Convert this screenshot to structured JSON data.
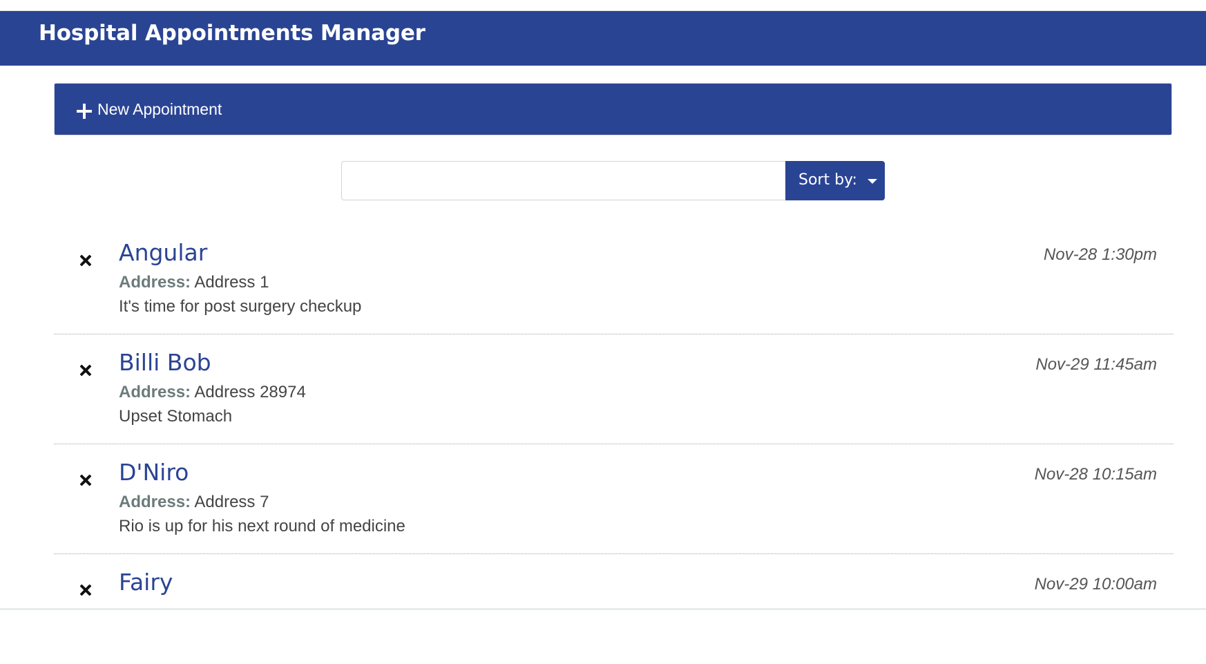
{
  "app": {
    "title": "Hospital Appointments Manager"
  },
  "toolbar": {
    "new_appointment_label": "New Appointment"
  },
  "search": {
    "value": "",
    "placeholder": ""
  },
  "sort": {
    "label": "Sort by:"
  },
  "appointments": [
    {
      "name": "Angular",
      "address_label": "Address:",
      "address": "Address 1",
      "notes": "It's time for post surgery checkup",
      "date": "Nov-28 1:30pm"
    },
    {
      "name": "Billi Bob",
      "address_label": "Address:",
      "address": "Address 28974",
      "notes": "Upset Stomach",
      "date": "Nov-29 11:45am"
    },
    {
      "name": "D'Niro",
      "address_label": "Address:",
      "address": "Address 7",
      "notes": "Rio is up for his next round of medicine",
      "date": "Nov-28 10:15am"
    },
    {
      "name": "Fairy",
      "address_label": "",
      "address": "",
      "notes": "",
      "date": "Nov-29 10:00am"
    }
  ],
  "colors": {
    "brand": "#2a4494",
    "accent_text": "#6c7a7a"
  }
}
